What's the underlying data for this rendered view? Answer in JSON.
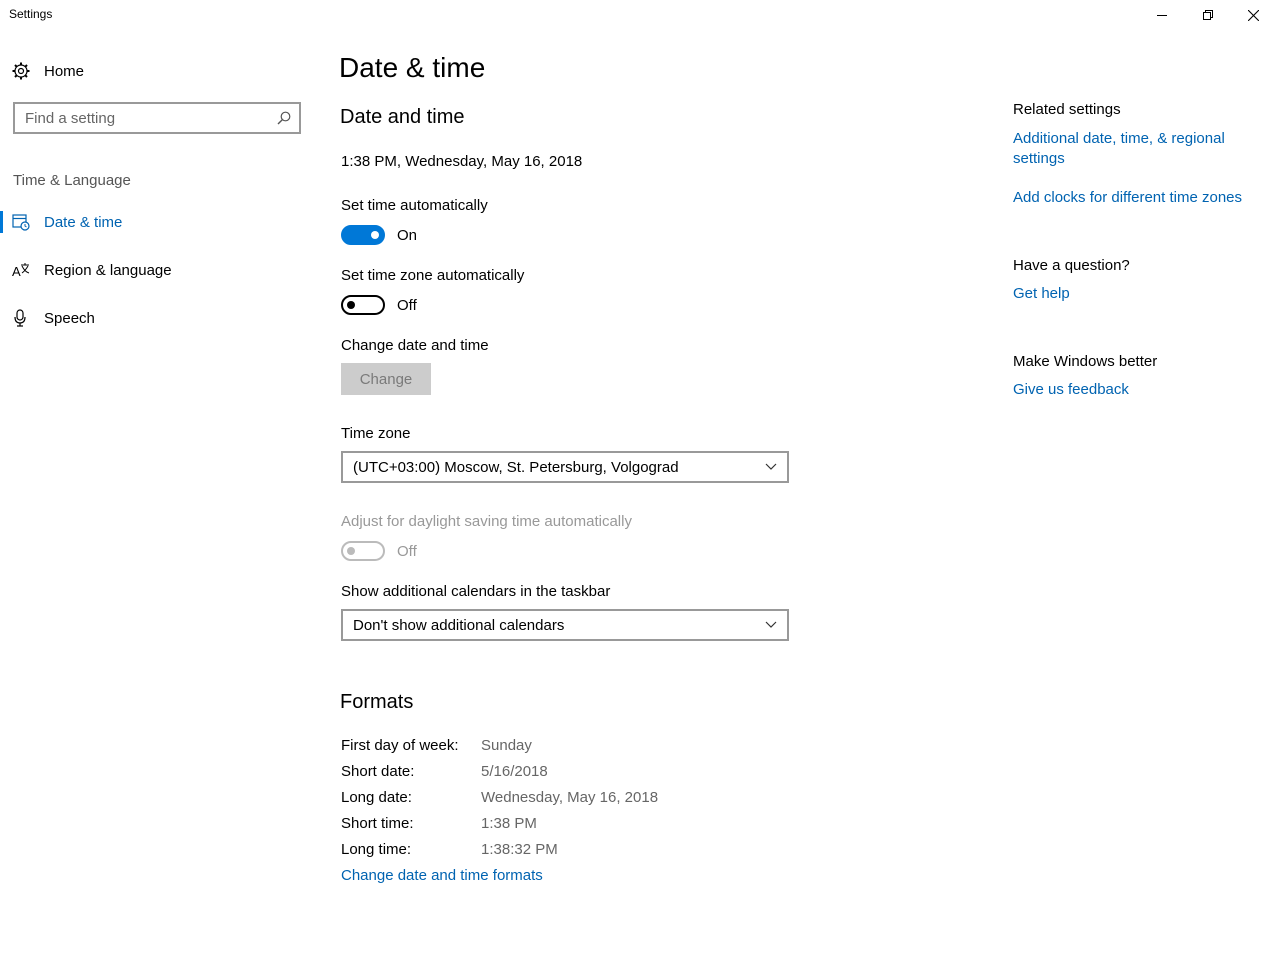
{
  "window": {
    "title": "Settings"
  },
  "sidebar": {
    "home_label": "Home",
    "search_placeholder": "Find a setting",
    "section_label": "Time & Language",
    "items": [
      {
        "label": "Date & time",
        "icon": "calendar-clock-icon",
        "active": true
      },
      {
        "label": "Region & language",
        "icon": "language-icon",
        "active": false
      },
      {
        "label": "Speech",
        "icon": "microphone-icon",
        "active": false
      }
    ]
  },
  "main": {
    "page_title": "Date & time",
    "section_title": "Date and time",
    "current_datetime": "1:38 PM, Wednesday, May 16, 2018",
    "set_time_auto": {
      "label": "Set time automatically",
      "state": "On"
    },
    "set_tz_auto": {
      "label": "Set time zone automatically",
      "state": "Off"
    },
    "change_dt": {
      "label": "Change date and time",
      "button": "Change"
    },
    "time_zone": {
      "label": "Time zone",
      "value": "(UTC+03:00) Moscow, St. Petersburg, Volgograd"
    },
    "dst": {
      "label": "Adjust for daylight saving time automatically",
      "state": "Off"
    },
    "calendars": {
      "label": "Show additional calendars in the taskbar",
      "value": "Don't show additional calendars"
    },
    "formats": {
      "title": "Formats",
      "rows": [
        {
          "key": "First day of week:",
          "value": "Sunday"
        },
        {
          "key": "Short date:",
          "value": "5/16/2018"
        },
        {
          "key": "Long date:",
          "value": "Wednesday, May 16, 2018"
        },
        {
          "key": "Short time:",
          "value": "1:38 PM"
        },
        {
          "key": "Long time:",
          "value": "1:38:32 PM"
        }
      ],
      "change_link": "Change date and time formats"
    }
  },
  "related": {
    "heading": "Related settings",
    "link1": "Additional date, time, & regional settings",
    "link2": "Add clocks for different time zones",
    "question_heading": "Have a question?",
    "help_link": "Get help",
    "better_heading": "Make Windows better",
    "feedback_link": "Give us feedback"
  },
  "colors": {
    "accent": "#0078d7",
    "link": "#0063b1"
  }
}
